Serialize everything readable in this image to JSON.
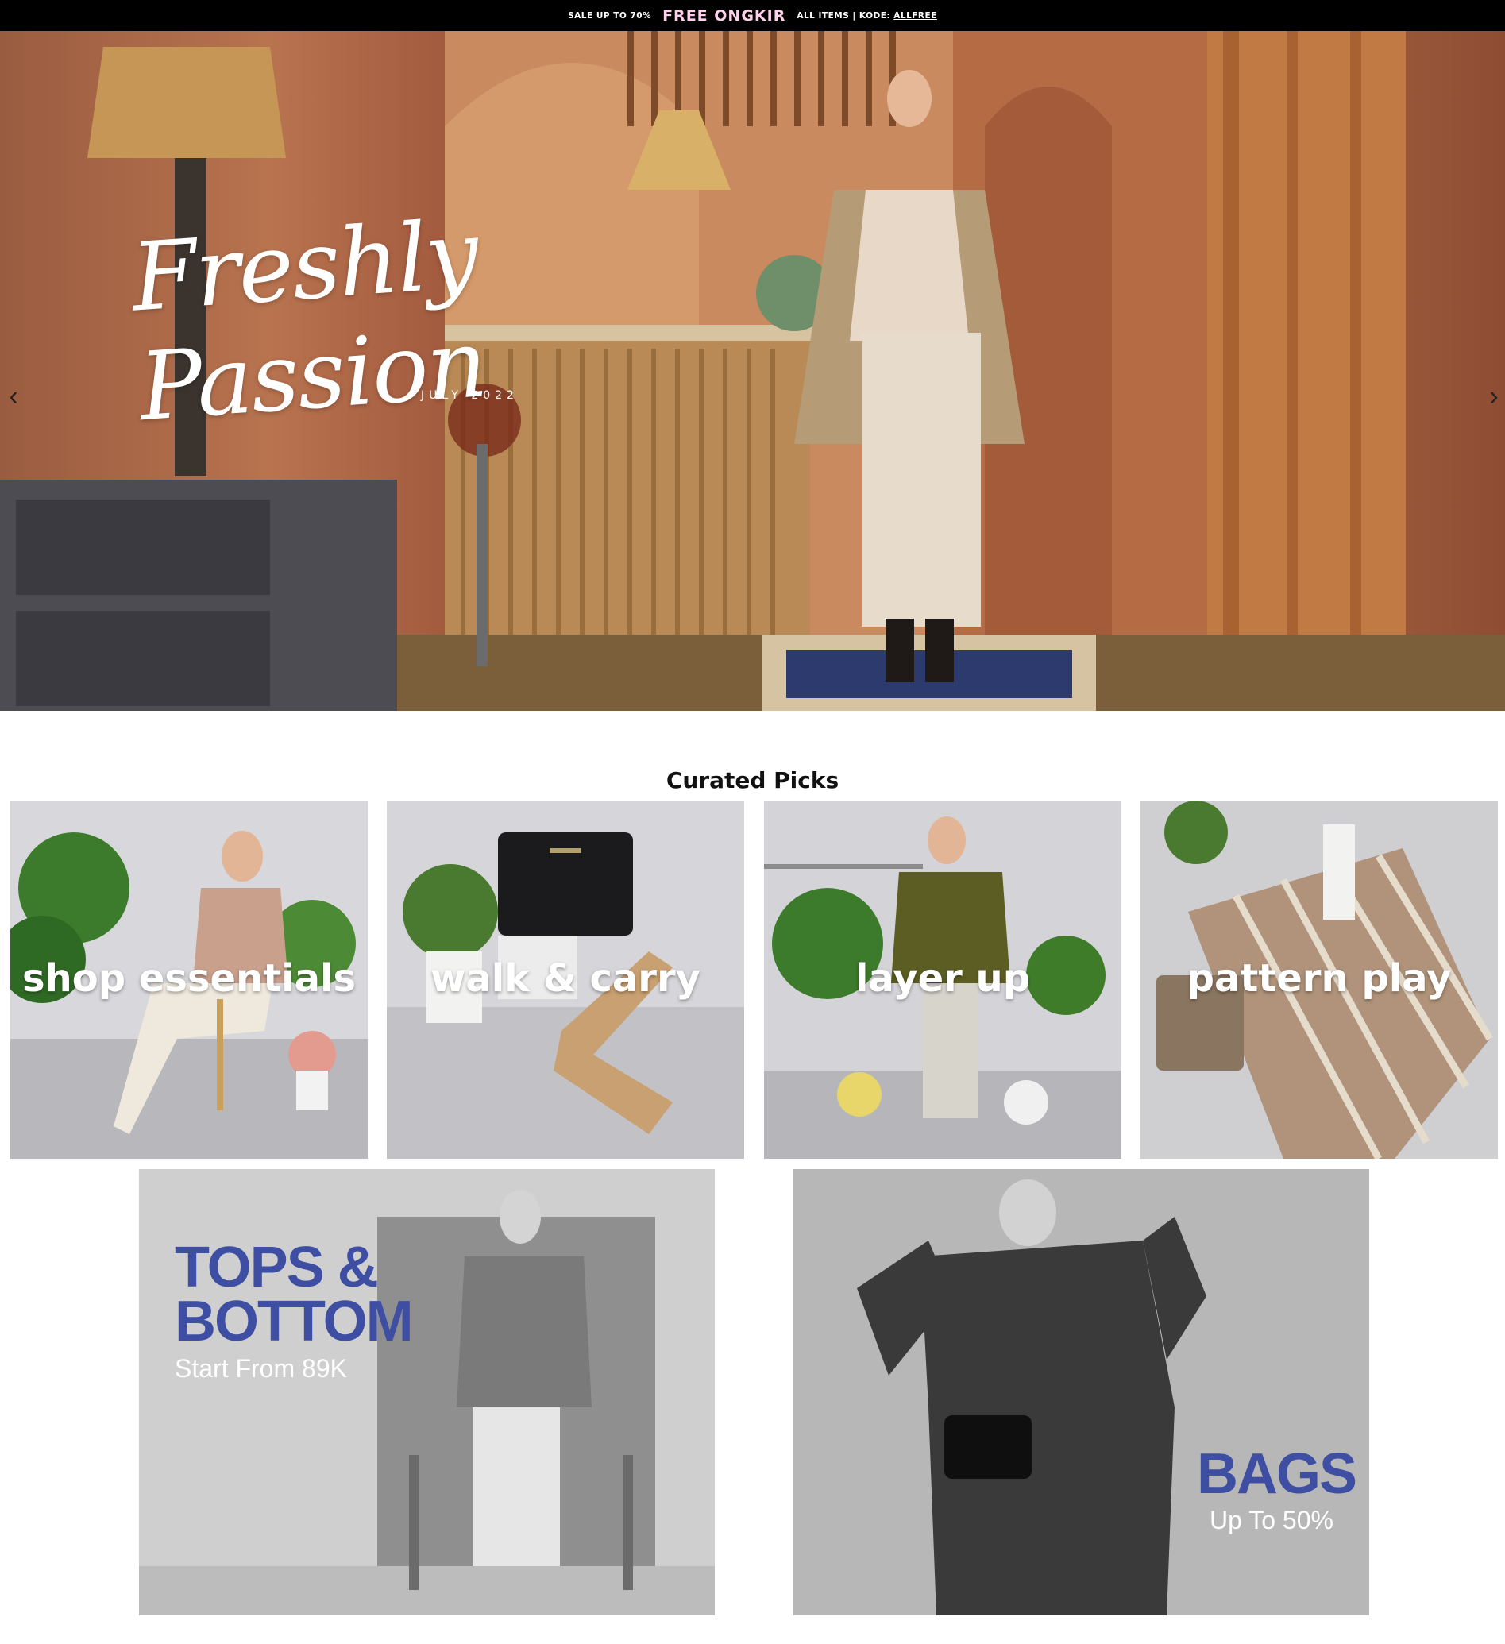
{
  "announcement": {
    "sale_text": "SALE UP TO 70%",
    "free_text": "FREE ONGKIR",
    "items_text": "ALL ITEMS | KODE:",
    "code": "ALLFREE"
  },
  "hero": {
    "title": "Freshly Passion",
    "subtitle": "JULY 2022",
    "prev_icon": "chevron-left-icon",
    "next_icon": "chevron-right-icon",
    "prev_glyph": "‹",
    "next_glyph": "›"
  },
  "curated": {
    "title": "Curated Picks",
    "tiles": [
      {
        "label": "shop essentials"
      },
      {
        "label": "walk & carry"
      },
      {
        "label": "layer up"
      },
      {
        "label": "pattern play"
      }
    ]
  },
  "promos": {
    "tops": {
      "line1": "TOPS &",
      "line2": "BOTTOM",
      "sub": "Start From 89K"
    },
    "bags": {
      "title": "BAGS",
      "sub": "Up To 50%"
    }
  },
  "colors": {
    "announcement_bg": "#000000",
    "free_ongkir": "#ffd1ea",
    "promo_heading": "#3e4fa3"
  }
}
